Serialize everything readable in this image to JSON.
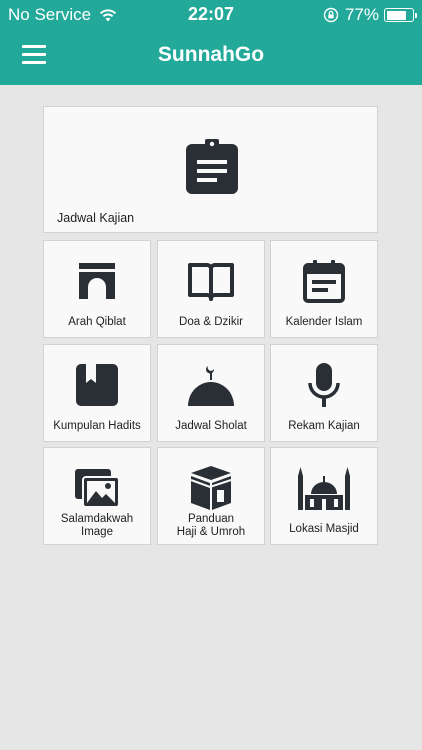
{
  "status_bar": {
    "carrier": "No Service",
    "time": "22:07",
    "battery_percent": "77%",
    "battery_level": 0.77,
    "icons": [
      "wifi-icon",
      "rotation-lock-icon",
      "battery-icon"
    ]
  },
  "app_bar": {
    "title": "SunnahGo",
    "menu_icon": "hamburger-menu-icon",
    "color": "#22a99a"
  },
  "featured": {
    "label": "Jadwal Kajian",
    "icon": "clipboard-icon"
  },
  "tiles": [
    {
      "label": "Arah Qiblat",
      "icon": "kaaba-arch-icon"
    },
    {
      "label": "Doa & Dzikir",
      "icon": "open-book-icon"
    },
    {
      "label": "Kalender Islam",
      "icon": "calendar-icon"
    },
    {
      "label": "Kumpulan Hadits",
      "icon": "bookmarked-book-icon"
    },
    {
      "label": "Jadwal Sholat",
      "icon": "mosque-dome-icon"
    },
    {
      "label": "Rekam Kajian",
      "icon": "microphone-icon"
    },
    {
      "label_lines": [
        "Salamdakwah",
        "Image"
      ],
      "icon": "image-gallery-icon"
    },
    {
      "label_lines": [
        "Panduan",
        "Haji & Umroh"
      ],
      "icon": "kaaba-icon"
    },
    {
      "label": "Lokasi Masjid",
      "icon": "mosque-minarets-icon"
    }
  ]
}
